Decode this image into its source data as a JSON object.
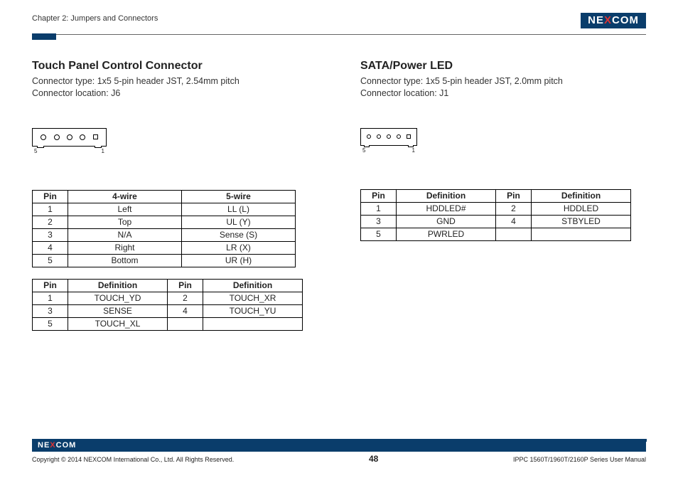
{
  "header": {
    "chapter": "Chapter 2: Jumpers and Connectors",
    "brand_left": "NE",
    "brand_x": "X",
    "brand_right": "COM"
  },
  "left": {
    "title": "Touch Panel Control Connector",
    "type_line": "Connector type: 1x5 5-pin header JST, 2.54mm pitch",
    "loc_line": "Connector location: J6",
    "pin_left": "5",
    "pin_right": "1",
    "table1": {
      "head": [
        "Pin",
        "4-wire",
        "5-wire"
      ],
      "rows": [
        [
          "1",
          "Left",
          "LL (L)"
        ],
        [
          "2",
          "Top",
          "UL (Y)"
        ],
        [
          "3",
          "N/A",
          "Sense (S)"
        ],
        [
          "4",
          "Right",
          "LR (X)"
        ],
        [
          "5",
          "Bottom",
          "UR (H)"
        ]
      ]
    },
    "table2": {
      "head": [
        "Pin",
        "Definition",
        "Pin",
        "Definition"
      ],
      "rows": [
        [
          "1",
          "TOUCH_YD",
          "2",
          "TOUCH_XR"
        ],
        [
          "3",
          "SENSE",
          "4",
          "TOUCH_YU"
        ],
        [
          "5",
          "TOUCH_XL",
          "",
          ""
        ]
      ]
    }
  },
  "right": {
    "title": "SATA/Power LED",
    "type_line": "Connector type: 1x5 5-pin header JST, 2.0mm pitch",
    "loc_line": "Connector location: J1",
    "pin_left": "5",
    "pin_right": "1",
    "table1": {
      "head": [
        "Pin",
        "Definition",
        "Pin",
        "Definition"
      ],
      "rows": [
        [
          "1",
          "HDDLED#",
          "2",
          "HDDLED"
        ],
        [
          "3",
          "GND",
          "4",
          "STBYLED"
        ],
        [
          "5",
          "PWRLED",
          "",
          ""
        ]
      ]
    }
  },
  "footer": {
    "brand_left": "NE",
    "brand_x": "X",
    "brand_right": "COM",
    "copyright": "Copyright © 2014 NEXCOM International Co., Ltd. All Rights Reserved.",
    "page": "48",
    "manual": "IPPC 1560T/1960T/2160P Series User Manual"
  }
}
